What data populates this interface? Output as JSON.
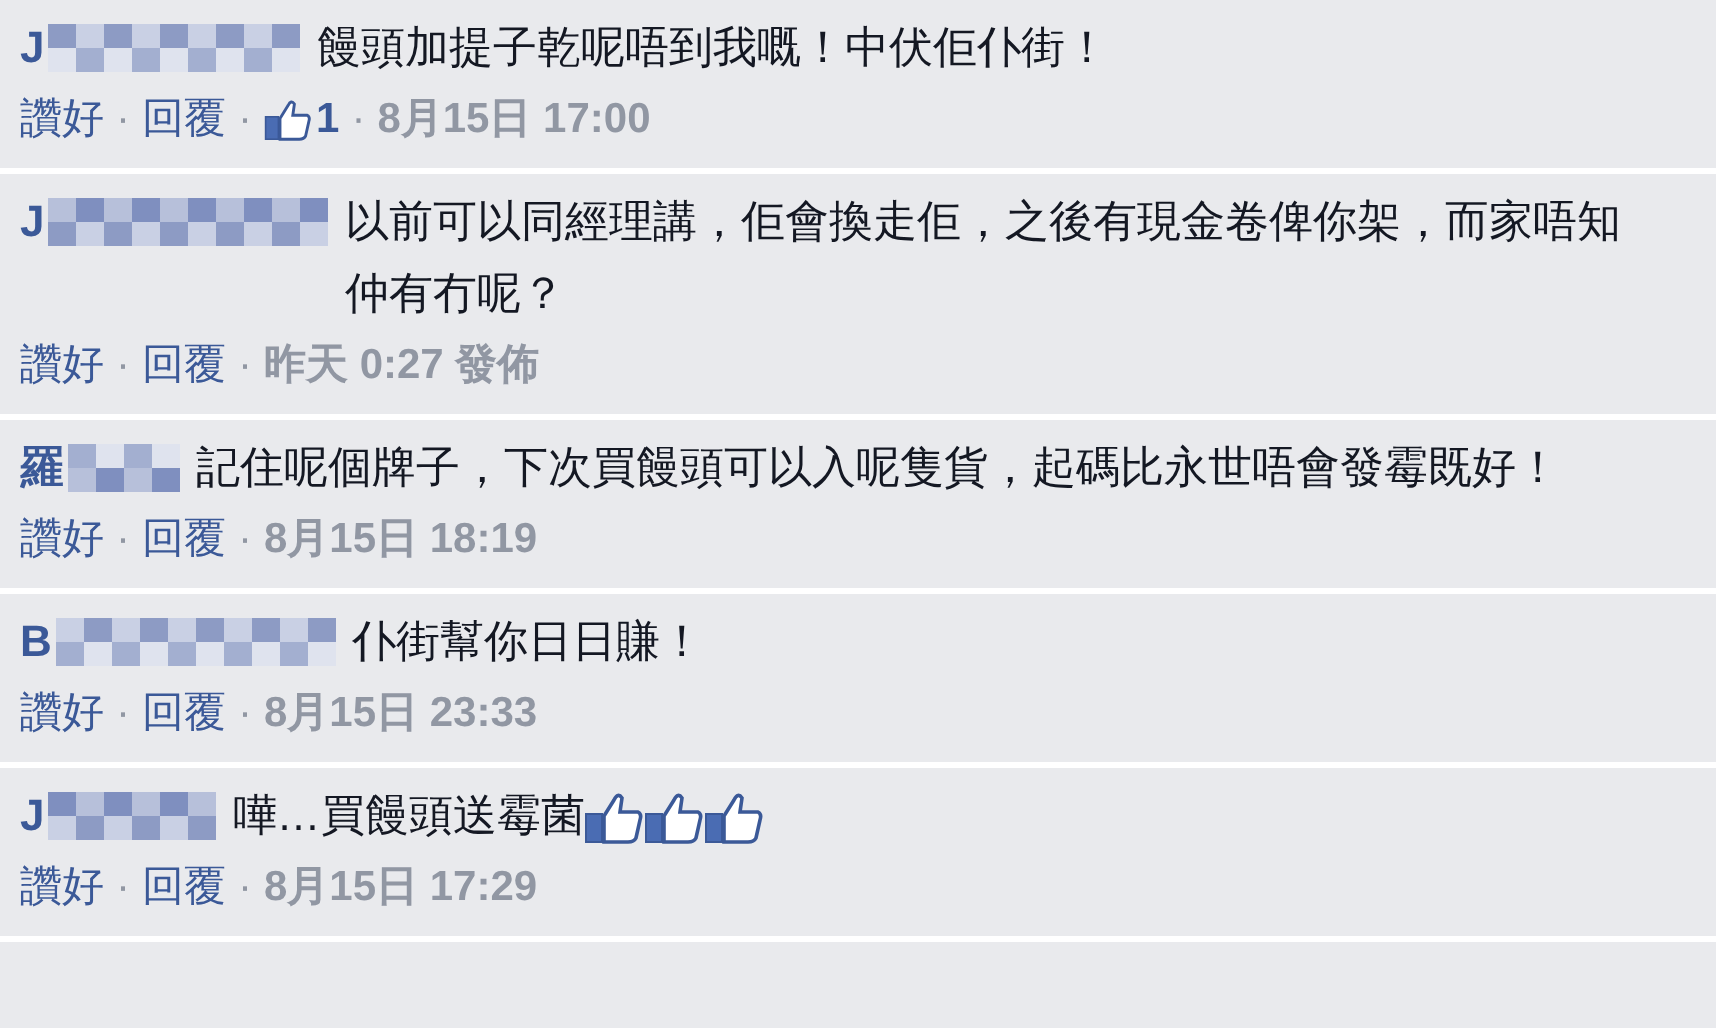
{
  "comments": [
    {
      "author": "J",
      "text": "饅頭加提子乾呢唔到我嘅！中伏佢仆街！",
      "meta": [
        {
          "kind": "link",
          "text": "讚好"
        },
        {
          "kind": "dot",
          "text": "·"
        },
        {
          "kind": "link",
          "text": "回覆"
        },
        {
          "kind": "dot",
          "text": "·"
        },
        {
          "kind": "likes",
          "text": "1"
        },
        {
          "kind": "dot",
          "text": "·"
        },
        {
          "kind": "time",
          "text": "8月15日 17:00"
        }
      ]
    },
    {
      "author": "J",
      "text": "以前可以同經理講，佢會換走佢，之後有現金卷俾你架，而家唔知仲有冇呢？",
      "meta": [
        {
          "kind": "link",
          "text": "讚好"
        },
        {
          "kind": "dot",
          "text": "·"
        },
        {
          "kind": "link",
          "text": "回覆"
        },
        {
          "kind": "dot",
          "text": "·"
        },
        {
          "kind": "time",
          "text": "昨天 0:27 發佈"
        }
      ]
    },
    {
      "author": "羅",
      "text": "記住呢個牌子，下次買饅頭可以入呢隻貨，起碼比永世唔會發霉既好！",
      "meta": [
        {
          "kind": "link",
          "text": "讚好"
        },
        {
          "kind": "dot",
          "text": "·"
        },
        {
          "kind": "link",
          "text": "回覆"
        },
        {
          "kind": "dot",
          "text": "·"
        },
        {
          "kind": "time",
          "text": "8月15日 18:19"
        }
      ]
    },
    {
      "author": "B",
      "text": "仆街幫你日日賺！",
      "meta": [
        {
          "kind": "link",
          "text": "讚好"
        },
        {
          "kind": "dot",
          "text": "·"
        },
        {
          "kind": "link",
          "text": "回覆"
        },
        {
          "kind": "dot",
          "text": "·"
        },
        {
          "kind": "time",
          "text": "8月15日 23:33"
        }
      ]
    },
    {
      "author": "J",
      "text": "嘩…買饅頭送霉菌",
      "emoticons": [
        {
          "kind": "like"
        },
        {
          "kind": "like"
        },
        {
          "kind": "like"
        }
      ],
      "meta": [
        {
          "kind": "link",
          "text": "讚好"
        },
        {
          "kind": "dot",
          "text": "·"
        },
        {
          "kind": "link",
          "text": "回覆"
        },
        {
          "kind": "dot",
          "text": "·"
        },
        {
          "kind": "time",
          "text": "8月15日 17:29"
        }
      ]
    }
  ]
}
